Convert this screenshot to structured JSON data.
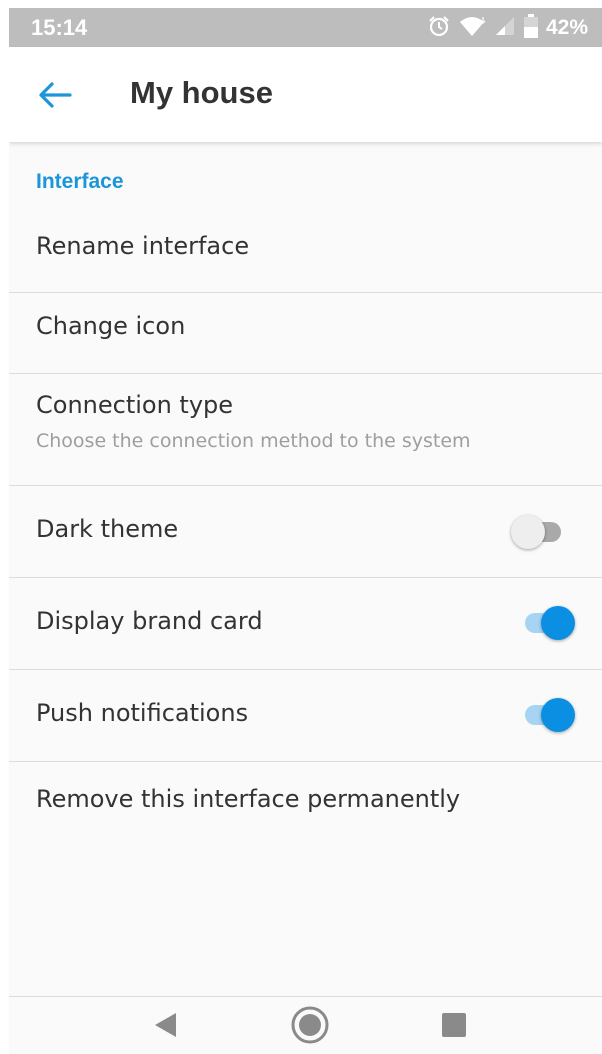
{
  "status_bar": {
    "time": "15:14",
    "battery_percent": "42%",
    "icons": [
      "alarm-icon",
      "wifi-icon",
      "cell-signal-icon",
      "battery-icon"
    ]
  },
  "app_bar": {
    "back_icon": "arrow-left-icon",
    "title": "My house"
  },
  "section": {
    "header": "Interface"
  },
  "items": {
    "rename": {
      "label": "Rename interface"
    },
    "change_icon": {
      "label": "Change icon"
    },
    "connection_type": {
      "label": "Connection type",
      "subtitle": "Choose the connection method to the system"
    },
    "dark_theme": {
      "label": "Dark theme",
      "enabled": false
    },
    "brand_card": {
      "label": "Display brand card",
      "enabled": true
    },
    "push_notifications": {
      "label": "Push notifications",
      "enabled": true
    },
    "remove": {
      "label": "Remove this interface permanently"
    }
  },
  "nav_bar": {
    "icons": [
      "back-triangle-icon",
      "home-circle-icon",
      "recents-square-icon"
    ]
  },
  "colors": {
    "accent": "#1a96d9",
    "switch_on": "#0a8fe2",
    "status_bar": "#bdbdbd"
  }
}
